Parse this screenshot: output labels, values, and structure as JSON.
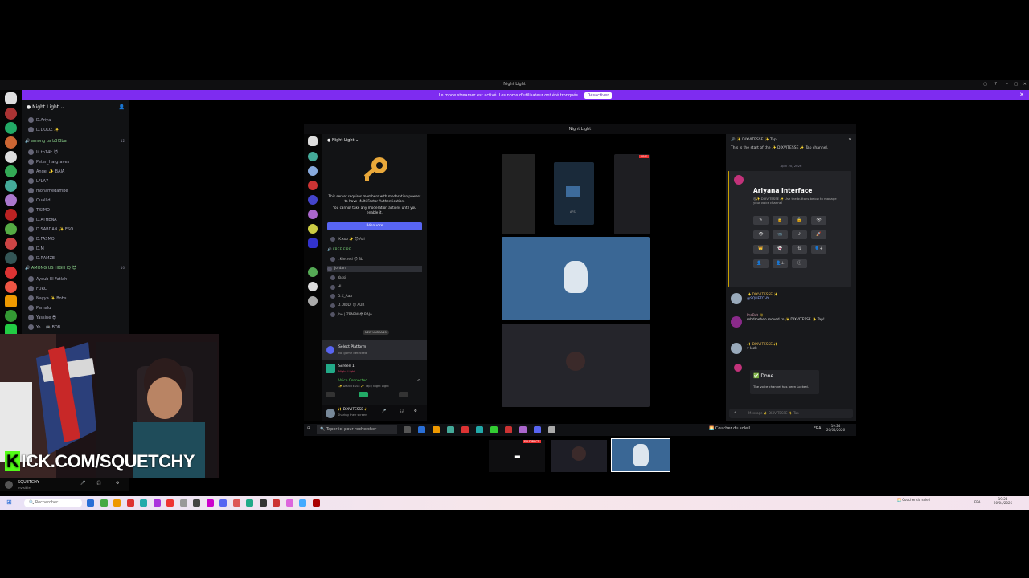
{
  "window": {
    "title": "Night Light"
  },
  "banner": {
    "text": "Le mode streamer est activé. Les noms d'utilisateur ont été tronqués.",
    "button": "Désactiver"
  },
  "sidebar": {
    "server_name": "Night Light",
    "top_items": [
      "D.Ariya",
      "D.DOOZ ✨"
    ],
    "categories": [
      {
        "name": "among us b3f3ba",
        "count": "12",
        "members": [
          "lil.th14k 😈",
          "Peter_Hargraves",
          "Angel ✨ BAJA",
          "LFLA7",
          "mohamedambe",
          "Ouallid",
          "T.SIMO",
          "D.ATHENA",
          "D.SABDAN ✨ ESO",
          "D.FASMO",
          "D.M",
          "D.RAMZE"
        ]
      },
      {
        "name": "AMONG US HIGH IQ 😈",
        "count": "10",
        "members": [
          "Ayoub El Fatlah",
          "FURC",
          "Nayya ✨ Bobs",
          "Pamalu",
          "Yassine 😎",
          "Yo... 🎮 BOB"
        ]
      }
    ]
  },
  "overlay": {
    "brand": "KICK.COM/SQUETCHY",
    "brand_prefix": "K",
    "brand_rest": "ICK.COM/SQUETCHY",
    "user": {
      "name": "SQUETCHY",
      "status": "Invisible"
    }
  },
  "inner_window": {
    "title": "Night Light",
    "server_name": "Night Light",
    "mfa": {
      "line1": "This server requires members with moderation powers to have Multi-Factor Authentication.",
      "line2": "You cannot take any moderation actions until you enable it.",
      "button": "Résoudre"
    },
    "channel_category": "FREE FIRE",
    "members": [
      "iK.xoo ✨ 😈 Aal",
      "I.Kincred 😈 BL",
      "Jordan",
      "Yassi",
      "Hl",
      "D.K_Aaa",
      "D.DIDDI 😈 AUR",
      "Jhe | ZPARM 😎 BAJA"
    ],
    "selected_member": "Jordan",
    "new_unreads": "NEW UNREADS",
    "platform": {
      "title": "Select Platform",
      "sub": "No game detected"
    },
    "screen": {
      "title": "Screen 1",
      "sub": "Night Light"
    },
    "voice": {
      "title": "Voice Connected",
      "sub": "✨ DIXVITESSE ✨ Tap / Night Light"
    },
    "user": {
      "name": "✨ DIXVITESSE ✨",
      "status": "Sharing their screen"
    },
    "stage": {
      "live_badge": "LIVE",
      "tile_label": "AFS"
    },
    "chat": {
      "header": "✨ DIXVITESSE ✨ Tap",
      "intro": "This is the start of the ✨ DIXVITESSE ✨ Tap channel.",
      "date": "April 20, 2026",
      "embed_title": "Ariyana Interface",
      "embed_desc": "@✨ DIXVITESSE ✨ Use the buttons below to manage your voice channel",
      "messages": [
        {
          "author": "✨ DIXVITESSE ✨",
          "text": "@SQUETCHY"
        },
        {
          "author": "ProBot ✨",
          "text": "mhdmeheb moved to ✨ DIXVITESSE ✨ Tap!"
        },
        {
          "author": "✨ DIXVITESSE ✨",
          "text": "v lock"
        }
      ],
      "done_title": "✅ Done",
      "done_text": "The voice channel has been Locked.",
      "input_placeholder": "Message ✨ DIXVITESSE ✨ Tap"
    },
    "taskbar": {
      "search": "Taper ici pour rechercher",
      "weather": "Coucher du soleil",
      "lang": "FRA",
      "time": "19:24",
      "date": "20/04/2026"
    }
  },
  "thumbs": {
    "live_badge": "EN DIRECT"
  },
  "taskbar": {
    "search": "Rechercher",
    "weather": "Coucher du soleil",
    "lang": "FRA",
    "time": "19:24",
    "date": "20/04/2026"
  },
  "colors": {
    "accent": "#7e2cf0",
    "kick": "#53fc18",
    "blurple": "#5865f2"
  }
}
